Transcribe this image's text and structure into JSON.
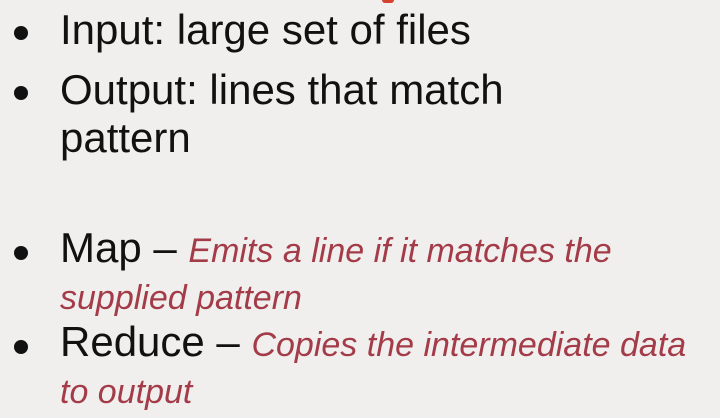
{
  "bullets": {
    "input": {
      "text": "Input: large set of files"
    },
    "output": {
      "text": "Output: lines that match pattern"
    },
    "map": {
      "term": "Map –",
      "description": "Emits a line if it matches the supplied pattern"
    },
    "reduce": {
      "term": "Reduce –",
      "description": "Copies the intermediate data to output"
    }
  },
  "colors": {
    "background": "#f1efee",
    "text": "#111111",
    "description": "#a33c48",
    "accent": "#d6402e"
  }
}
